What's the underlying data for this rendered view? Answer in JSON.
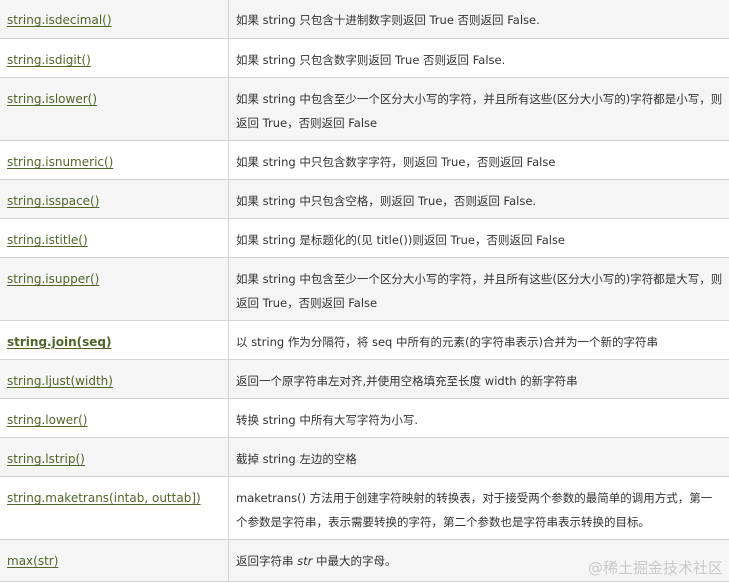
{
  "rows": [
    {
      "method": "string.isdecimal()",
      "desc": "如果 string 只包含十进制数字则返回 True 否则返回 False."
    },
    {
      "method": "string.isdigit()",
      "desc": "如果 string 只包含数字则返回 True 否则返回 False."
    },
    {
      "method": "string.islower()",
      "desc": "如果 string 中包含至少一个区分大小写的字符，并且所有这些(区分大小写的)字符都是小写，则返回 True，否则返回 False"
    },
    {
      "method": "string.isnumeric()",
      "desc": "如果 string 中只包含数字字符，则返回 True，否则返回 False"
    },
    {
      "method": "string.isspace()",
      "desc": "如果 string 中只包含空格，则返回 True，否则返回 False."
    },
    {
      "method": "string.istitle()",
      "desc": "如果 string 是标题化的(见 title())则返回 True，否则返回 False"
    },
    {
      "method": "string.isupper()",
      "desc": "如果 string 中包含至少一个区分大小写的字符，并且所有这些(区分大小写的)字符都是大写，则返回 True，否则返回 False"
    },
    {
      "method": "string.join(seq)",
      "desc": "以 string 作为分隔符，将 seq 中所有的元素(的字符串表示)合并为一个新的字符串"
    },
    {
      "method": "string.ljust(width)",
      "desc": "返回一个原字符串左对齐,并使用空格填充至长度 width 的新字符串"
    },
    {
      "method": "string.lower()",
      "desc": "转换 string 中所有大写字符为小写."
    },
    {
      "method": "string.lstrip()",
      "desc": "截掉 string 左边的空格"
    },
    {
      "method": "string.maketrans(intab, outtab])",
      "desc": "maketrans() 方法用于创建字符映射的转换表，对于接受两个参数的最简单的调用方式，第一个参数是字符串，表示需要转换的字符，第二个参数也是字符串表示转换的目标。"
    },
    {
      "method": "max(str)",
      "desc_before": "返回字符串 ",
      "desc_em": "str",
      "desc_after": " 中最大的字母。"
    }
  ],
  "watermark": {
    "icon": "juejin-logo-icon",
    "text": "@稀土掘金技术社区"
  },
  "colors": {
    "link": "#4f6628",
    "text": "#333333",
    "border": "#d4d4d4",
    "row_alt": "#f5f5f5"
  }
}
